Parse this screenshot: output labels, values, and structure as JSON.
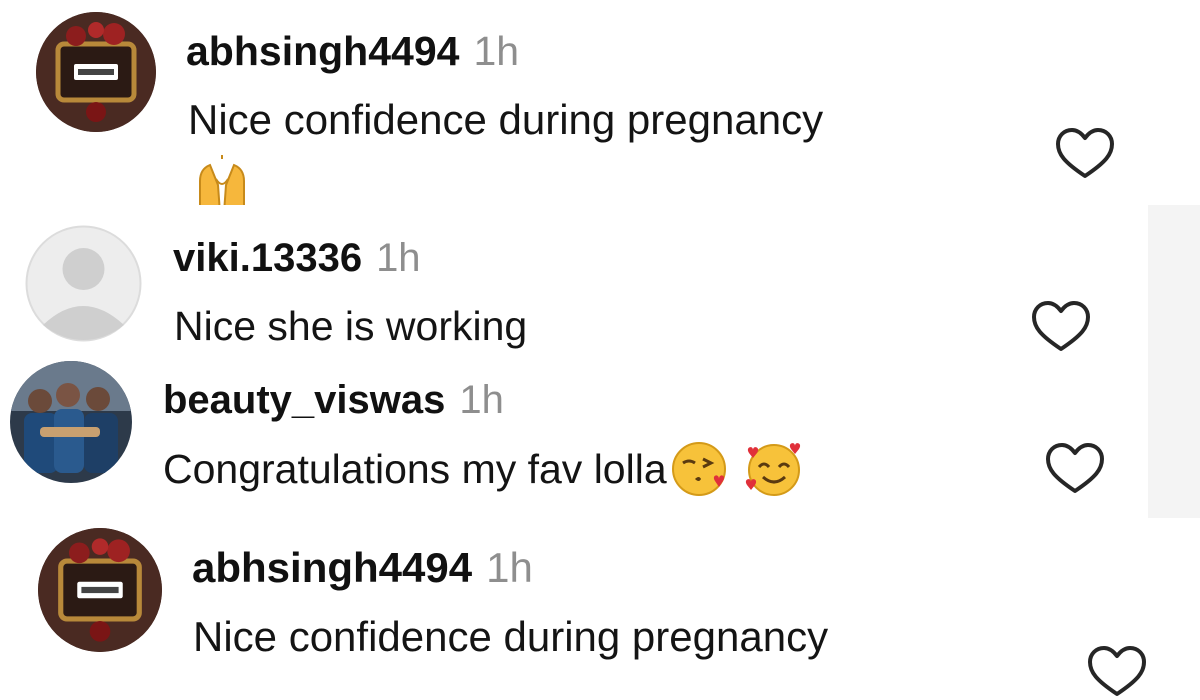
{
  "comments": [
    {
      "username": "abhsingh4494",
      "time": "1h",
      "text": "Nice confidence during pregnancy",
      "emoji": [
        "praising-hands"
      ],
      "avatar": "framed-logo-avatar",
      "liked": false
    },
    {
      "username": "viki.13336",
      "time": "1h",
      "text": "Nice she is working",
      "emoji": [],
      "avatar": "default-profile-avatar",
      "liked": false
    },
    {
      "username": "beauty_viswas",
      "time": "1h",
      "text": "Congratulations my fav lolla",
      "emoji": [
        "face-blowing-kiss",
        "smiling-face-with-hearts"
      ],
      "avatar": "group-photo-avatar",
      "liked": false
    },
    {
      "username": "abhsingh4494",
      "time": "1h",
      "text": "Nice confidence during pregnancy",
      "emoji": [],
      "avatar": "framed-logo-avatar",
      "liked": false
    }
  ],
  "colors": {
    "username": "#111111",
    "timestamp": "#8e8e8e",
    "heart_outline": "#262626",
    "background": "#ffffff"
  }
}
